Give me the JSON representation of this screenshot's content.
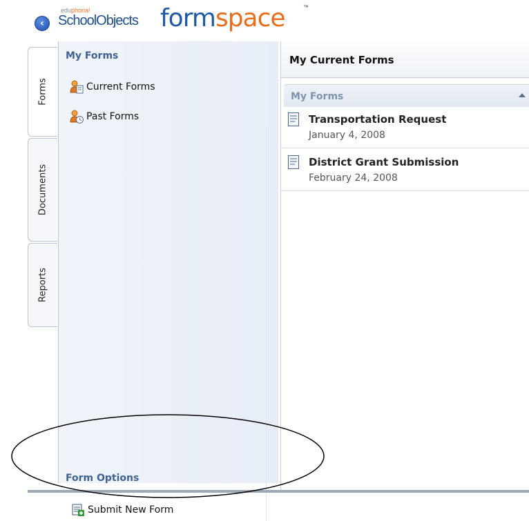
{
  "header": {
    "brand_small_prefix": "edu",
    "brand_small_accent": "phoria!",
    "brand_school": "SchoolObjects",
    "brand_form": "form",
    "brand_space": "space",
    "brand_tm": "™",
    "back_icon": "arrow-left-icon"
  },
  "tabs": [
    {
      "label": "Forms",
      "active": true
    },
    {
      "label": "Documents",
      "active": false
    },
    {
      "label": "Reports",
      "active": false
    }
  ],
  "left_panel": {
    "my_forms_title": "My Forms",
    "items": [
      {
        "label": "Current Forms",
        "icon": "current-forms-icon"
      },
      {
        "label": "Past Forms",
        "icon": "past-forms-icon"
      }
    ],
    "form_options_title": "Form Options",
    "options": [
      {
        "label": "Submit New Form",
        "icon": "submit-new-form-icon"
      }
    ]
  },
  "right_panel": {
    "header_title": "My Current Forms",
    "group_title": "My Forms",
    "forms": [
      {
        "title": "Transportation Request",
        "date": "January 4, 2008"
      },
      {
        "title": "District Grant Submission",
        "date": "February 24, 2008"
      }
    ]
  },
  "colors": {
    "brand_blue": "#1f5aa4",
    "brand_orange": "#e96d1c",
    "section_title": "#3f6390"
  }
}
